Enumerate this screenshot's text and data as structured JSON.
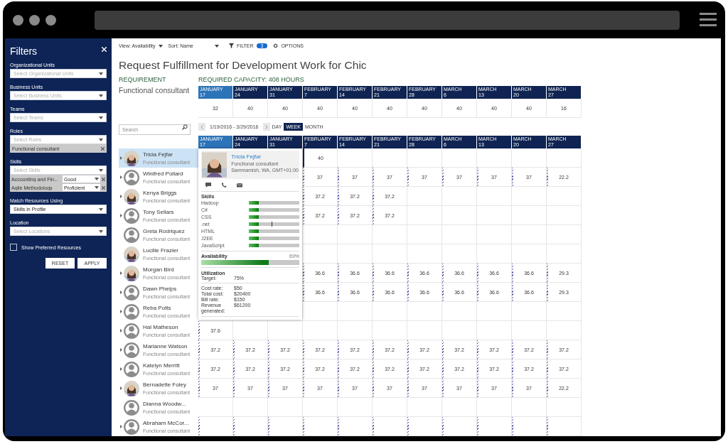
{
  "sidebar": {
    "title": "Filters",
    "groups": [
      {
        "label": "Organizational Units",
        "placeholder": "Select Organizational Units"
      },
      {
        "label": "Business Units",
        "placeholder": "Select Business Units"
      },
      {
        "label": "Teams",
        "placeholder": "Select Teams"
      },
      {
        "label": "Roles",
        "placeholder": "Select Roles",
        "tags": [
          "Functional consultant"
        ]
      },
      {
        "label": "Skills",
        "placeholder": "Select Skills",
        "skill_rows": [
          {
            "name": "Accounting and Fin...",
            "rating": "Good"
          },
          {
            "name": "Agile Methodology",
            "rating": "Proficient"
          }
        ]
      },
      {
        "label": "Match Resources Using",
        "value": "Skills in Profile"
      },
      {
        "label": "Location",
        "placeholder": "Select Locations"
      }
    ],
    "checkbox": {
      "label": "Show Preferred Resources",
      "checked": false
    },
    "buttons": [
      "RESET",
      "APPLY"
    ]
  },
  "toolbar": {
    "view": "View: Availability",
    "sort": "Sort: Name",
    "filter": "FILTER",
    "filter_count": "3",
    "options": "OPTIONS"
  },
  "title": "Request Fulfillment for Development Work for Chic",
  "requirement": {
    "label": "REQUIREMENT",
    "capacity": "REQUIRED CAPACITY: 408 HOURS",
    "role": "Functional consultant",
    "weeks": [
      {
        "month": "JANUARY",
        "day": "17",
        "selected": true
      },
      {
        "month": "JANUARY",
        "day": "24",
        "selected": false
      },
      {
        "month": "JANUARY",
        "day": "31",
        "selected": false
      },
      {
        "month": "FEBRUARY",
        "day": "7",
        "selected": false
      },
      {
        "month": "FEBRUARY",
        "day": "14",
        "selected": false
      },
      {
        "month": "FEBRUARY",
        "day": "21",
        "selected": false
      },
      {
        "month": "FEBRUARY",
        "day": "28",
        "selected": false
      },
      {
        "month": "MARCH",
        "day": "6",
        "selected": false
      },
      {
        "month": "MARCH",
        "day": "13",
        "selected": false
      },
      {
        "month": "MARCH",
        "day": "20",
        "selected": false
      },
      {
        "month": "MARCH",
        "day": "27",
        "selected": false
      }
    ],
    "hours": [
      "32",
      "40",
      "40",
      "40",
      "40",
      "40",
      "40",
      "40",
      "40",
      "40",
      "16"
    ]
  },
  "search": {
    "placeholder": "Search"
  },
  "date_range": "1/19/2016 - 3/29/2016",
  "views": [
    {
      "label": "DAY",
      "selected": false
    },
    {
      "label": "WEEK",
      "selected": true
    },
    {
      "label": "MONTH",
      "selected": false
    }
  ],
  "schedule": {
    "weeks": [
      {
        "month": "JANUARY",
        "day": "17",
        "selected": true
      },
      {
        "month": "JANUARY",
        "day": "24",
        "selected": false
      },
      {
        "month": "JANUARY",
        "day": "31",
        "selected": false
      },
      {
        "month": "FEBRUARY",
        "day": "7",
        "selected": false
      },
      {
        "month": "FEBRUARY",
        "day": "14",
        "selected": false
      },
      {
        "month": "FEBRUARY",
        "day": "21",
        "selected": false
      },
      {
        "month": "FEBRUARY",
        "day": "28",
        "selected": false
      },
      {
        "month": "MARCH",
        "day": "6",
        "selected": false
      },
      {
        "month": "MARCH",
        "day": "13",
        "selected": false
      },
      {
        "month": "MARCH",
        "day": "20",
        "selected": false
      },
      {
        "month": "MARCH",
        "day": "27",
        "selected": false
      }
    ],
    "resources": [
      {
        "name": "Tricia Fejfar",
        "role": "Functional consultant",
        "expandable": true,
        "selected": true,
        "cells": [
          {
            "kind": "covered"
          },
          {
            "kind": "covered"
          },
          {
            "kind": "covered"
          },
          {
            "kind": "current",
            "hours": "40"
          },
          {
            "kind": "blank"
          },
          {
            "kind": "blank"
          },
          {
            "kind": "blank"
          },
          {
            "kind": "blank"
          },
          {
            "kind": "blank"
          },
          {
            "kind": "blank"
          },
          {
            "kind": "blank"
          }
        ]
      },
      {
        "name": "Winifred Pollard",
        "role": "Functional consultant",
        "kind": "silhouette",
        "expandable": true,
        "selected": false,
        "cells": [
          {
            "kind": "covered"
          },
          {
            "kind": "covered"
          },
          {
            "kind": "covered"
          },
          {
            "kind": "booked",
            "hours": "37"
          },
          {
            "kind": "booked",
            "hours": "37"
          },
          {
            "kind": "booked",
            "hours": "37"
          },
          {
            "kind": "booked",
            "hours": "37"
          },
          {
            "kind": "booked",
            "hours": "37"
          },
          {
            "kind": "booked",
            "hours": "37"
          },
          {
            "kind": "booked",
            "hours": "37"
          },
          {
            "kind": "booked",
            "hours": "22.2"
          }
        ]
      },
      {
        "name": "Kenya Briggs",
        "role": "Functional consultant",
        "expandable": true,
        "selected": false,
        "cells": [
          {
            "kind": "covered"
          },
          {
            "kind": "covered"
          },
          {
            "kind": "covered"
          },
          {
            "kind": "booked",
            "hours": "37.2"
          },
          {
            "kind": "booked",
            "hours": "37.2"
          },
          {
            "kind": "booked",
            "hours": "37.2"
          },
          {
            "kind": "blank"
          },
          {
            "kind": "blank"
          },
          {
            "kind": "blank"
          },
          {
            "kind": "blank"
          },
          {
            "kind": "blank"
          }
        ]
      },
      {
        "name": "Tony Sellars",
        "role": "Functional consultant",
        "kind": "silhouette",
        "expandable": true,
        "selected": false,
        "cells": [
          {
            "kind": "covered"
          },
          {
            "kind": "covered"
          },
          {
            "kind": "covered"
          },
          {
            "kind": "booked",
            "hours": "37.2"
          },
          {
            "kind": "booked",
            "hours": "37.2"
          },
          {
            "kind": "booked",
            "hours": "37.2"
          },
          {
            "kind": "blank"
          },
          {
            "kind": "blank"
          },
          {
            "kind": "blank"
          },
          {
            "kind": "blank"
          },
          {
            "kind": "blank"
          }
        ]
      },
      {
        "name": "Greta Rodriquez",
        "role": "Functional consultant",
        "kind": "silhouette",
        "expandable": false,
        "selected": false,
        "cells": [
          {
            "kind": "covered"
          },
          {
            "kind": "covered"
          },
          {
            "kind": "covered"
          },
          {
            "kind": "blank"
          },
          {
            "kind": "blank"
          },
          {
            "kind": "blank"
          },
          {
            "kind": "blank"
          },
          {
            "kind": "blank"
          },
          {
            "kind": "blank"
          },
          {
            "kind": "blank"
          },
          {
            "kind": "blank"
          }
        ]
      },
      {
        "name": "Lucille Frazier",
        "role": "Functional consultant",
        "expandable": false,
        "selected": false,
        "cells": [
          {
            "kind": "covered"
          },
          {
            "kind": "covered"
          },
          {
            "kind": "covered"
          },
          {
            "kind": "blank"
          },
          {
            "kind": "blank"
          },
          {
            "kind": "blank"
          },
          {
            "kind": "blank"
          },
          {
            "kind": "blank"
          },
          {
            "kind": "blank"
          },
          {
            "kind": "blank"
          },
          {
            "kind": "blank"
          }
        ]
      },
      {
        "name": "Morgan Bird",
        "role": "Functional consultant",
        "expandable": true,
        "selected": false,
        "cells": [
          {
            "kind": "covered"
          },
          {
            "kind": "covered"
          },
          {
            "kind": "covered"
          },
          {
            "kind": "booked",
            "hours": "36.6"
          },
          {
            "kind": "booked",
            "hours": "36.6"
          },
          {
            "kind": "booked",
            "hours": "36.6"
          },
          {
            "kind": "booked",
            "hours": "36.6"
          },
          {
            "kind": "booked",
            "hours": "36.6"
          },
          {
            "kind": "booked",
            "hours": "36.6"
          },
          {
            "kind": "booked",
            "hours": "36.6"
          },
          {
            "kind": "booked",
            "hours": "29.3"
          }
        ]
      },
      {
        "name": "Dawn Phelps",
        "role": "Functional consultant",
        "kind": "silhouette",
        "expandable": true,
        "selected": false,
        "cells": [
          {
            "kind": "covered"
          },
          {
            "kind": "covered"
          },
          {
            "kind": "covered"
          },
          {
            "kind": "booked",
            "hours": "36.6"
          },
          {
            "kind": "booked",
            "hours": "36.6"
          },
          {
            "kind": "booked",
            "hours": "36.6"
          },
          {
            "kind": "booked",
            "hours": "36.6"
          },
          {
            "kind": "booked",
            "hours": "36.6"
          },
          {
            "kind": "booked",
            "hours": "36.6"
          },
          {
            "kind": "booked",
            "hours": "36.6"
          },
          {
            "kind": "booked",
            "hours": "29.3"
          }
        ]
      },
      {
        "name": "Reba Potts",
        "role": "Functional consultant",
        "kind": "silhouette",
        "expandable": true,
        "selected": false,
        "cells": [
          {
            "kind": "covered"
          },
          {
            "kind": "covered"
          },
          {
            "kind": "blank"
          },
          {
            "kind": "blank"
          },
          {
            "kind": "blank"
          },
          {
            "kind": "blank"
          },
          {
            "kind": "blank"
          },
          {
            "kind": "blank"
          },
          {
            "kind": "blank"
          },
          {
            "kind": "blank"
          },
          {
            "kind": "blank"
          }
        ]
      },
      {
        "name": "Hal Matheson",
        "role": "Functional consultant",
        "kind": "silhouette",
        "expandable": true,
        "selected": false,
        "cells": [
          {
            "kind": "booked",
            "hours": "37.6"
          },
          {
            "kind": "blank"
          },
          {
            "kind": "blank"
          },
          {
            "kind": "blank"
          },
          {
            "kind": "blank"
          },
          {
            "kind": "blank"
          },
          {
            "kind": "blank"
          },
          {
            "kind": "blank"
          },
          {
            "kind": "blank"
          },
          {
            "kind": "blank"
          },
          {
            "kind": "blank"
          }
        ]
      },
      {
        "name": "Marianne Watson",
        "role": "Functional consultant",
        "kind": "silhouette",
        "expandable": true,
        "selected": false,
        "cells": [
          {
            "kind": "booked",
            "hours": "37.2"
          },
          {
            "kind": "booked",
            "hours": "37.2"
          },
          {
            "kind": "booked",
            "hours": "37.2"
          },
          {
            "kind": "booked",
            "hours": "37.2"
          },
          {
            "kind": "booked",
            "hours": "37.2"
          },
          {
            "kind": "booked",
            "hours": "37.2"
          },
          {
            "kind": "booked",
            "hours": "37.2"
          },
          {
            "kind": "booked",
            "hours": "37.2"
          },
          {
            "kind": "booked",
            "hours": "37.2"
          },
          {
            "kind": "booked",
            "hours": "37.2"
          },
          {
            "kind": "booked",
            "hours": "37.2"
          }
        ]
      },
      {
        "name": "Katelyn Merritt",
        "role": "Functional consultant",
        "kind": "silhouette",
        "expandable": true,
        "selected": false,
        "cells": [
          {
            "kind": "booked",
            "hours": "37.2"
          },
          {
            "kind": "booked",
            "hours": "37.2"
          },
          {
            "kind": "booked",
            "hours": "37.2"
          },
          {
            "kind": "booked",
            "hours": "37.2"
          },
          {
            "kind": "booked",
            "hours": "37.2"
          },
          {
            "kind": "booked",
            "hours": "37.2"
          },
          {
            "kind": "booked",
            "hours": "37.2"
          },
          {
            "kind": "booked",
            "hours": "37.2"
          },
          {
            "kind": "booked",
            "hours": "37.2"
          },
          {
            "kind": "booked",
            "hours": "37.2"
          },
          {
            "kind": "booked",
            "hours": "37.2"
          }
        ]
      },
      {
        "name": "Bernadette Foley",
        "role": "Functional consultant",
        "expandable": true,
        "selected": false,
        "cells": [
          {
            "kind": "booked",
            "hours": "37"
          },
          {
            "kind": "booked",
            "hours": "37"
          },
          {
            "kind": "booked",
            "hours": "37"
          },
          {
            "kind": "booked",
            "hours": "37"
          },
          {
            "kind": "booked",
            "hours": "37"
          },
          {
            "kind": "booked",
            "hours": "37"
          },
          {
            "kind": "booked",
            "hours": "37"
          },
          {
            "kind": "booked",
            "hours": "37"
          },
          {
            "kind": "booked",
            "hours": "37"
          },
          {
            "kind": "booked",
            "hours": "37"
          },
          {
            "kind": "booked",
            "hours": "22.2"
          }
        ]
      },
      {
        "name": "Dianna Woodw...",
        "role": "Functional consultant",
        "kind": "silhouette",
        "expandable": false,
        "selected": false,
        "cells": [
          {
            "kind": "blank"
          },
          {
            "kind": "blank"
          },
          {
            "kind": "blank"
          },
          {
            "kind": "blank"
          },
          {
            "kind": "blank"
          },
          {
            "kind": "blank"
          },
          {
            "kind": "blank"
          },
          {
            "kind": "blank"
          },
          {
            "kind": "blank"
          },
          {
            "kind": "blank"
          },
          {
            "kind": "blank"
          }
        ]
      },
      {
        "name": "Abraham McCor...",
        "role": "Functional consultant",
        "kind": "silhouette",
        "expandable": true,
        "selected": false,
        "cells": [
          {
            "kind": "booked"
          },
          {
            "kind": "booked"
          },
          {
            "kind": "booked"
          },
          {
            "kind": "booked"
          },
          {
            "kind": "booked"
          },
          {
            "kind": "booked"
          },
          {
            "kind": "booked"
          },
          {
            "kind": "booked"
          },
          {
            "kind": "booked"
          },
          {
            "kind": "booked"
          },
          {
            "kind": "booked"
          }
        ]
      }
    ]
  },
  "popup": {
    "name": "Tricia Fejfar",
    "role": "Functional consultant",
    "location": "Sammamish, WA, GMT+01:00",
    "skills_title": "Skills",
    "skills": [
      {
        "name": "Hadoop",
        "level": 0.2,
        "marked": false
      },
      {
        "name": "C#",
        "level": 0.2,
        "marked": false
      },
      {
        "name": "CSS",
        "level": 0.2,
        "marked": false
      },
      {
        "name": ".net",
        "level": 0.2,
        "marked": true
      },
      {
        "name": "HTML",
        "level": 0.2,
        "marked": false
      },
      {
        "name": "J2EE",
        "level": 0.2,
        "marked": false
      },
      {
        "name": "JavaScript",
        "level": 0.2,
        "marked": false
      }
    ],
    "availability": {
      "label": "Availability",
      "reading": "69%",
      "level": 0.69
    },
    "utilization": {
      "title": "Utilization",
      "target_label": "Target:",
      "target_value": "75%"
    },
    "figures": [
      {
        "label": "Cost rate:",
        "value": "$50"
      },
      {
        "label": "Total cost:",
        "value": "$20400"
      },
      {
        "label": "Bill rate:",
        "value": "$150"
      },
      {
        "label": "Revenue generated:",
        "value": "$61200"
      }
    ]
  }
}
